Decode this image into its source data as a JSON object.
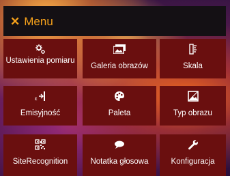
{
  "header": {
    "close_icon": "close-x-icon",
    "title": "Menu"
  },
  "colors": {
    "accent": "#f7a21b",
    "topbar_bg": "#141014",
    "tile_bg": "#6a0f0f",
    "tile_text": "#ffffff"
  },
  "tiles": [
    {
      "label": "Ustawienia pomiaru",
      "icon": "measurement-settings-icon"
    },
    {
      "label": "Galeria obrazów",
      "icon": "image-gallery-icon"
    },
    {
      "label": "Skala",
      "icon": "scale-icon"
    },
    {
      "label": "Emisyjność",
      "icon": "emissivity-icon"
    },
    {
      "label": "Paleta",
      "icon": "palette-icon"
    },
    {
      "label": "Typ obrazu",
      "icon": "image-type-icon"
    },
    {
      "label": "SiteRecognition",
      "icon": "qr-code-icon"
    },
    {
      "label": "Notatka głosowa",
      "icon": "speech-bubble-icon"
    },
    {
      "label": "Konfiguracja",
      "icon": "wrench-icon"
    }
  ]
}
